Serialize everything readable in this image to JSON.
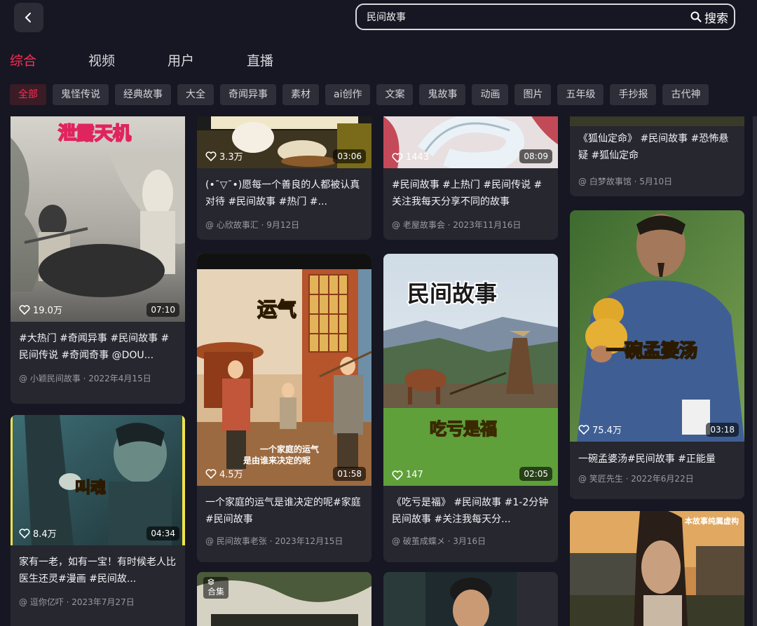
{
  "header": {
    "search_query": "民间故事",
    "search_label": "搜索"
  },
  "tabs": [
    "综合",
    "视频",
    "用户",
    "直播"
  ],
  "chips": [
    "全部",
    "鬼怪传说",
    "经典故事",
    "大全",
    "奇闻异事",
    "素材",
    "ai创作",
    "文案",
    "鬼故事",
    "动画",
    "图片",
    "五年级",
    "手抄报",
    "古代神"
  ],
  "cards": {
    "c1": {
      "overlay": "泄露天机",
      "likes": "19.0万",
      "duration": "07:10",
      "title": "#大热门 #奇闻异事 #民间故事 #民间传说 #奇闻奇事 @DOU...",
      "meta": "@ 小颖民间故事 · 2022年4月15日"
    },
    "c2": {
      "overlay": "叫魂",
      "likes": "8.4万",
      "duration": "04:34",
      "title": "家有一老，如有一宝！有时候老人比医生还灵#漫画 #民间故...",
      "meta": "@ 逗你亿吓 · 2023年7月27日"
    },
    "c3": {
      "likes": "3.3万",
      "duration": "03:06",
      "title": "(•¯▽¯•)愿每一个善良的人都被认真对待 #民间故事 #热门 #...",
      "meta": "@ 心欣故事汇 · 9月12日"
    },
    "c4": {
      "overlay": "运气",
      "caption1": "一个家庭的运气",
      "caption2": "是由谁来决定的呢",
      "likes": "4.5万",
      "duration": "01:58",
      "title": "一个家庭的运气是谁决定的呢#家庭#民间故事",
      "meta": "@ 民间故事老张 · 2023年12月15日"
    },
    "c5": {
      "badge": "合集"
    },
    "c6": {
      "likes": "1443",
      "duration": "08:09",
      "title": "#民间故事 #上热门 #民间传说 #关注我每天分享不同的故事",
      "meta": "@ 老屋故事会 · 2023年11月16日"
    },
    "c7": {
      "overlay": "民间故事",
      "overlay2": "吃亏是福",
      "likes": "147",
      "duration": "02:05",
      "title": "《吃亏是福》 #民间故事 #1-2分钟民间故事 #关注我每天分...",
      "meta": "@ 破茧成蝶メ · 3月16日"
    },
    "c9": {
      "title": "《狐仙定命》 #民间故事 #恐怖悬疑 #狐仙定命",
      "meta": "@ 白梦故事馆 · 5月10日"
    },
    "c10": {
      "overlay": "一碗孟婆汤",
      "likes": "75.4万",
      "duration": "03:18",
      "title": "一碗孟婆汤#民间故事 #正能量",
      "meta": "@ 笑匠先生 · 2022年6月22日"
    },
    "c11": {
      "overlay": "本故事纯属虚构"
    }
  },
  "colors": {
    "accent": "#fe2c55",
    "background": "#161722",
    "card": "#26272f"
  }
}
